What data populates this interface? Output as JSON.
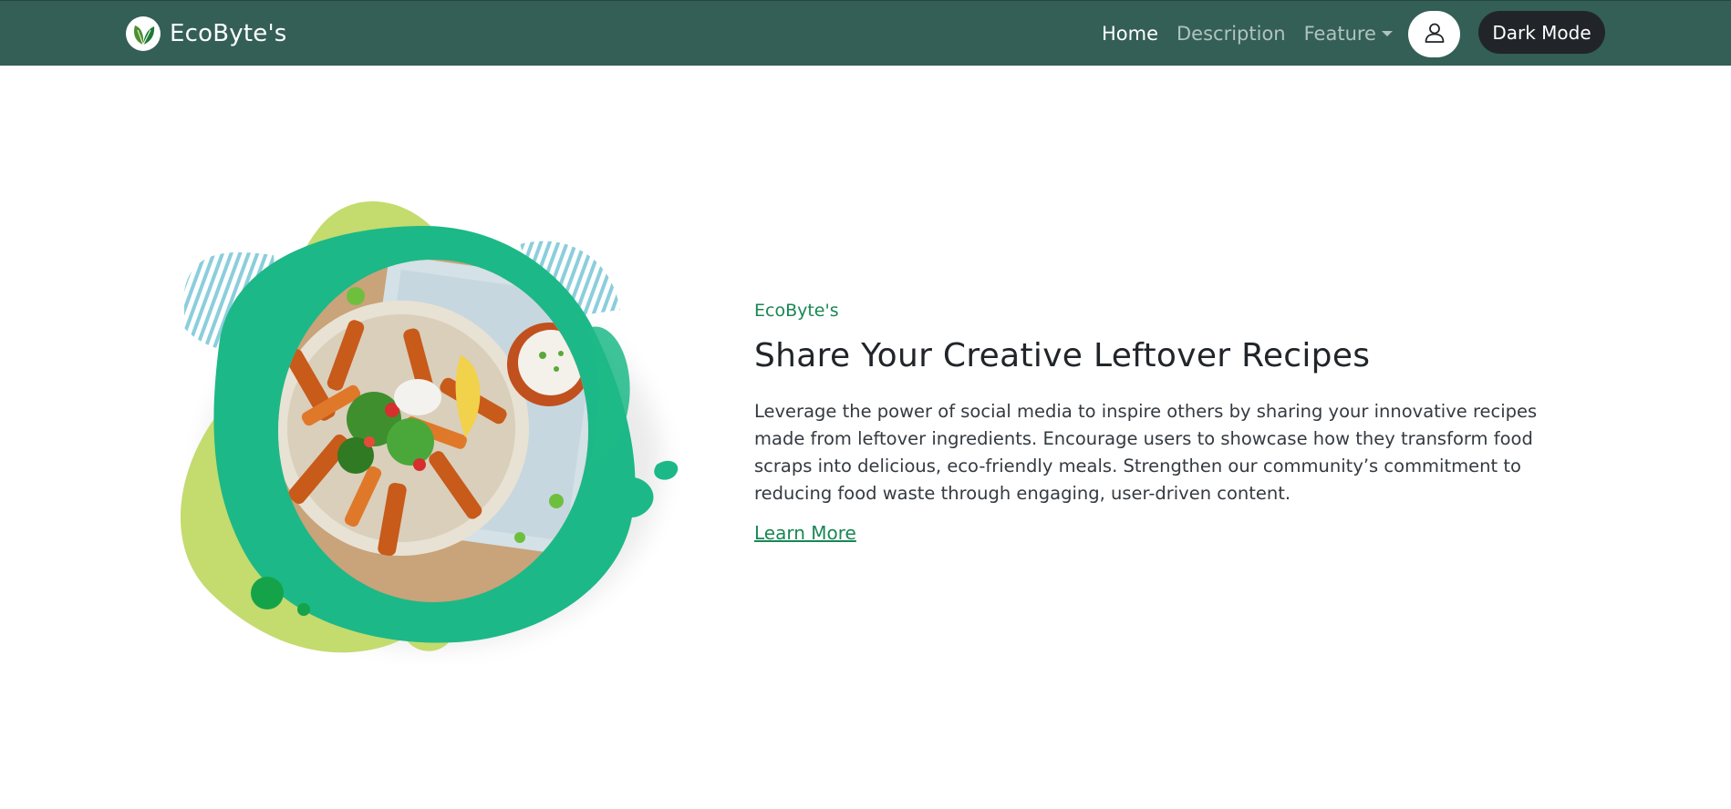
{
  "navbar": {
    "brand": "EcoByte's",
    "logo_icon": "leaf-icon",
    "links": [
      {
        "label": "Home",
        "active": true
      },
      {
        "label": "Description",
        "active": false
      },
      {
        "label": "Feature",
        "active": false,
        "dropdown": true
      }
    ],
    "user_icon": "user-icon",
    "dark_mode_label": "Dark Mode"
  },
  "hero": {
    "eyebrow": "EcoByte's",
    "headline": "Share Your Creative Leftover Recipes",
    "description": "Leverage the power of social media to inspire others by sharing your innovative recipes made from leftover ingredients. Encourage users to showcase how they transform food scraps into delicious, eco-friendly meals. Strengthen our community’s commitment to reducing food waste through engaging, user-driven content.",
    "link_label": "Learn More",
    "image_subject": "sweet potato fries bowl with salad and dip"
  },
  "colors": {
    "navbar_bg": "#335f56",
    "accent_green": "#198754",
    "blob_teal": "#1db887",
    "blob_lime": "#c4db6e",
    "stripe_blue": "#7ec8d8",
    "dark_button": "#212529"
  }
}
